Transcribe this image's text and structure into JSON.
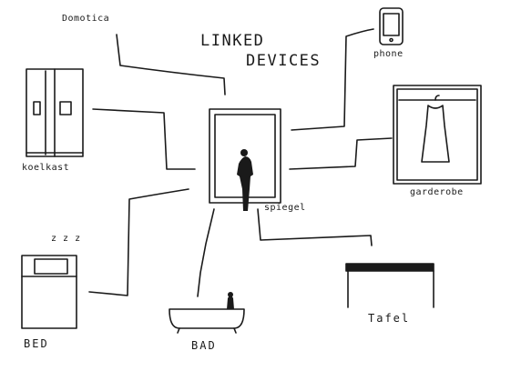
{
  "title": {
    "line1": "LINKED",
    "line2": "DEVICES"
  },
  "labels": {
    "domotica": "Domotica",
    "koelkast": "koelkast",
    "phone": "phone",
    "garderobe": "garderobe",
    "spiegel": "spiegel",
    "bed": "BED",
    "bad": "BAD",
    "tafel": "Tafel",
    "zzz": "z z z"
  },
  "colors": {
    "ink": "#1a1a1a",
    "paper": "#ffffff"
  }
}
